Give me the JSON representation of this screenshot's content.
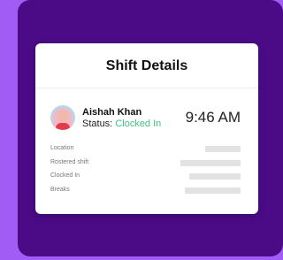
{
  "card": {
    "title": "Shift Details"
  },
  "employee": {
    "name": "Aishah Khan",
    "status_label": "Status:",
    "status_value": "Clocked In",
    "time": "9:46 AM"
  },
  "details": [
    {
      "label": "Location"
    },
    {
      "label": "Rostered shift"
    },
    {
      "label": "Clocked In"
    },
    {
      "label": "Breaks"
    }
  ],
  "colors": {
    "outer_background": "#a25cf6",
    "panel_background": "#4b0b87",
    "status_green": "#3fc480"
  }
}
